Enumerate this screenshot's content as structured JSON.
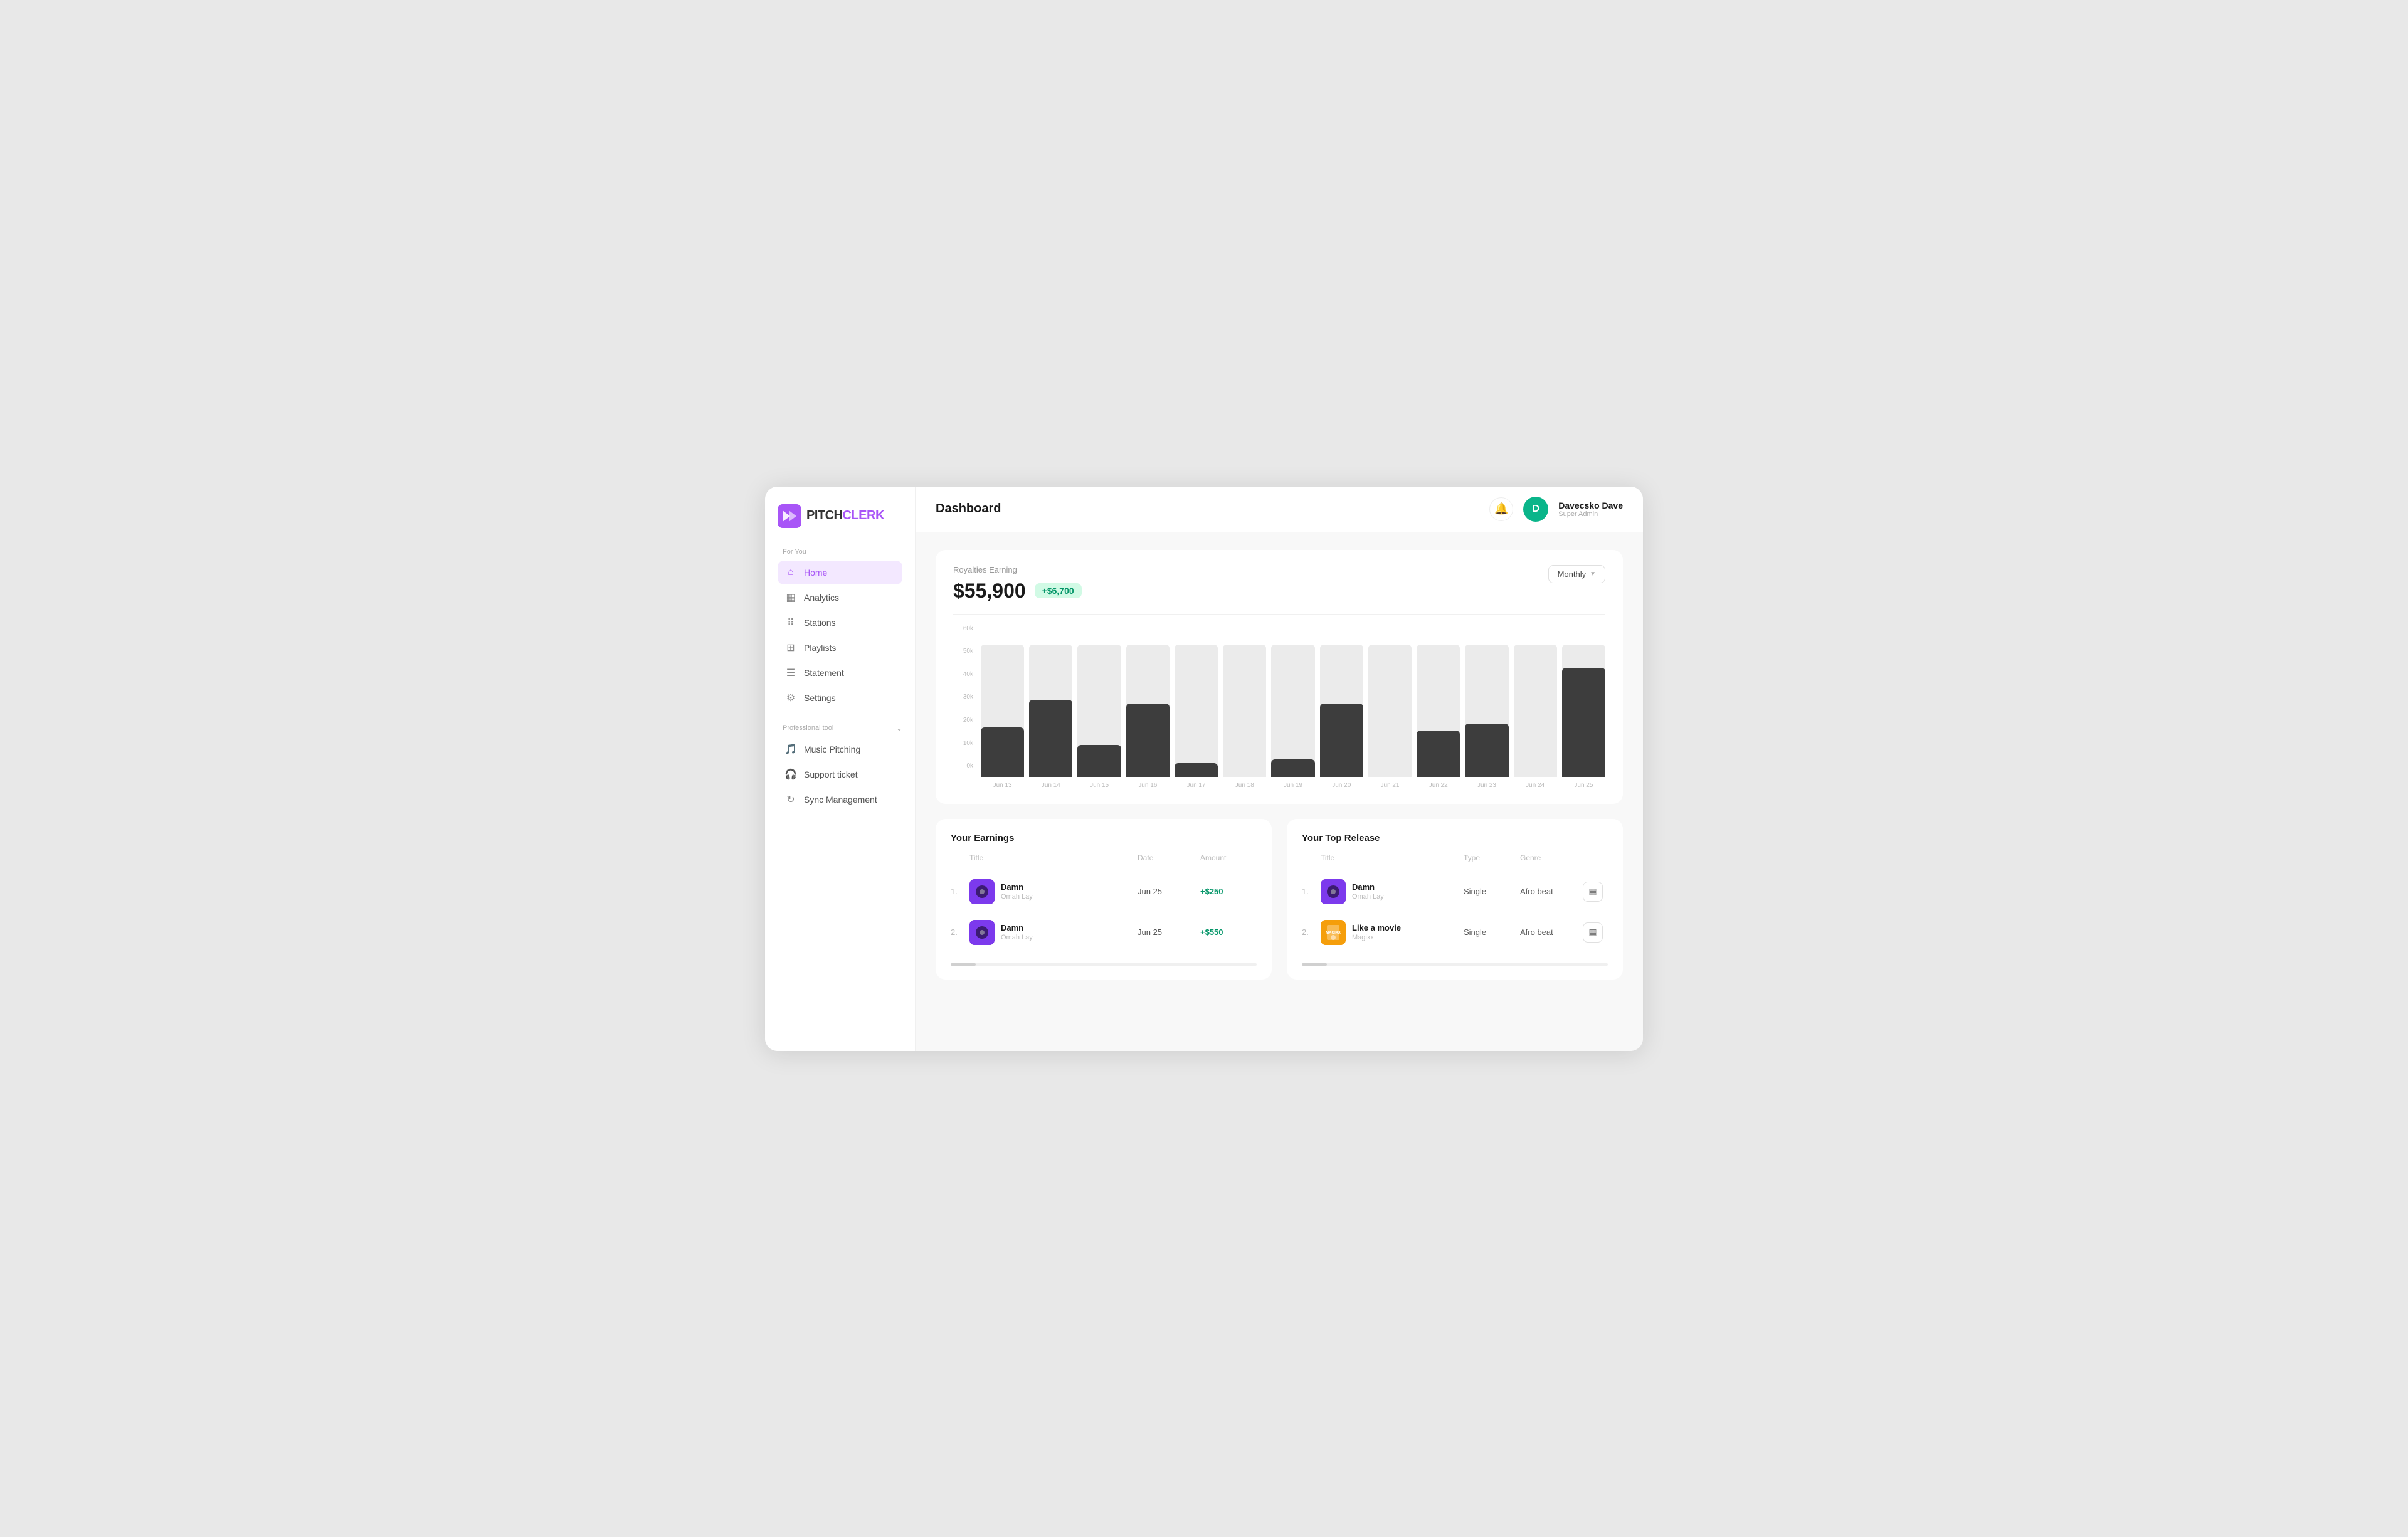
{
  "app": {
    "name": "PITCHCLERK",
    "name_pitch": "PITCH",
    "name_clerk": "CLERK"
  },
  "header": {
    "page_title": "Dashboard",
    "notification_icon": "🔔",
    "user": {
      "avatar_initial": "D",
      "name": "Davecsko Dave",
      "role": "Super Admin"
    }
  },
  "sidebar": {
    "for_you_label": "For You",
    "items": [
      {
        "id": "home",
        "label": "Home",
        "active": true
      },
      {
        "id": "analytics",
        "label": "Analytics",
        "active": false
      },
      {
        "id": "stations",
        "label": "Stations",
        "active": false
      },
      {
        "id": "playlists",
        "label": "Playlists",
        "active": false
      },
      {
        "id": "statement",
        "label": "Statement",
        "active": false
      },
      {
        "id": "settings",
        "label": "Settings",
        "active": false
      }
    ],
    "pro_section_label": "Professional tool",
    "pro_items": [
      {
        "id": "music-pitching",
        "label": "Music Pitching"
      },
      {
        "id": "support-ticket",
        "label": "Support ticket"
      },
      {
        "id": "sync-management",
        "label": "Sync Management"
      }
    ]
  },
  "chart": {
    "title": "Royalties Earning",
    "amount": "$55,900",
    "badge": "+$6,700",
    "period_selector": "Monthly",
    "y_labels": [
      "60k",
      "50k",
      "40k",
      "30k",
      "20k",
      "10k",
      "0k"
    ],
    "bars": [
      {
        "label": "Jun 13",
        "fill_pct": 37,
        "track_pct": 100
      },
      {
        "label": "Jun 14",
        "fill_pct": 58,
        "track_pct": 100
      },
      {
        "label": "Jun 15",
        "fill_pct": 24,
        "track_pct": 100
      },
      {
        "label": "Jun 16",
        "fill_pct": 55,
        "track_pct": 100
      },
      {
        "label": "Jun 17",
        "fill_pct": 10,
        "track_pct": 100
      },
      {
        "label": "Jun 18",
        "fill_pct": 0,
        "track_pct": 100
      },
      {
        "label": "Jun 19",
        "fill_pct": 13,
        "track_pct": 100
      },
      {
        "label": "Jun 20",
        "fill_pct": 55,
        "track_pct": 100
      },
      {
        "label": "Jun 21",
        "fill_pct": 0,
        "track_pct": 100
      },
      {
        "label": "Jun 22",
        "fill_pct": 35,
        "track_pct": 100
      },
      {
        "label": "Jun 23",
        "fill_pct": 40,
        "track_pct": 100
      },
      {
        "label": "Jun 24",
        "fill_pct": 0,
        "track_pct": 100
      },
      {
        "label": "Jun 25",
        "fill_pct": 82,
        "track_pct": 100
      }
    ]
  },
  "earnings": {
    "panel_title": "Your Earnings",
    "columns": {
      "title": "Title",
      "date": "Date",
      "amount": "Amount"
    },
    "rows": [
      {
        "num": "1.",
        "track": "Damn",
        "artist": "Omah Lay",
        "date": "Jun 25",
        "amount": "+$250"
      },
      {
        "num": "2.",
        "track": "Damn",
        "artist": "Omah Lay",
        "date": "Jun 25",
        "amount": "+$550"
      }
    ]
  },
  "top_release": {
    "panel_title": "Your Top Release",
    "columns": {
      "title": "Title",
      "type": "Type",
      "genre": "Genre"
    },
    "rows": [
      {
        "num": "1.",
        "track": "Damn",
        "artist": "Omah Lay",
        "type": "Single",
        "genre": "Afro beat",
        "thumb": "damn"
      },
      {
        "num": "2.",
        "track": "Like a movie",
        "artist": "Magixx",
        "type": "Single",
        "genre": "Afro beat",
        "thumb": "magixx"
      }
    ]
  }
}
